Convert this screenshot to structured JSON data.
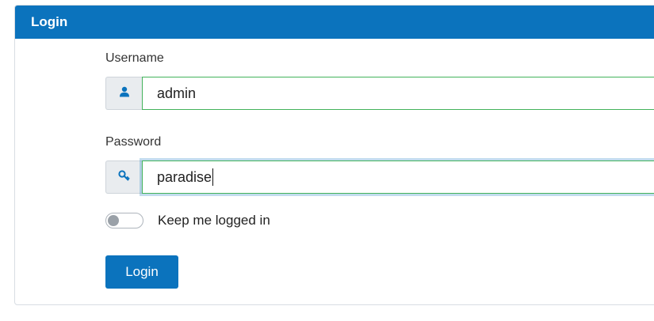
{
  "card": {
    "title": "Login"
  },
  "username": {
    "label": "Username",
    "value": "admin",
    "icon": "user-icon"
  },
  "password": {
    "label": "Password",
    "value": "paradise",
    "icon": "key-icon"
  },
  "remember": {
    "label": "Keep me logged in",
    "checked": false
  },
  "submit": {
    "label": "Login"
  },
  "colors": {
    "primary": "#0b73bd",
    "valid_border": "#43b35b",
    "icon": "#0b73bd"
  }
}
